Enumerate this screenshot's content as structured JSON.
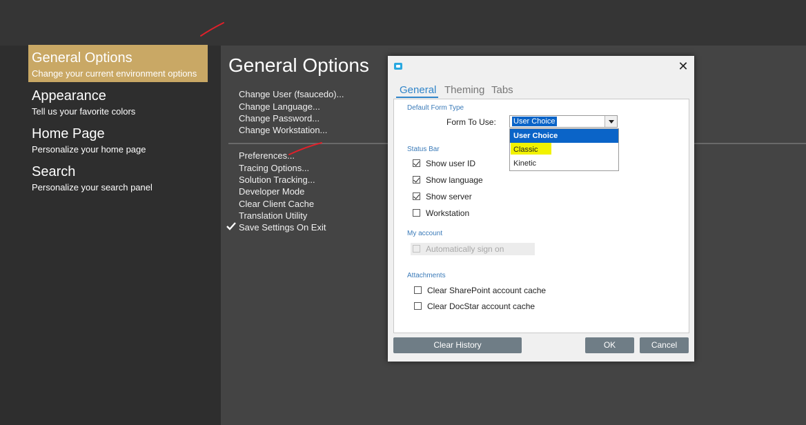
{
  "nav": {
    "items": [
      {
        "title": "General Options",
        "subtitle": "Change your current environment options",
        "active": true
      },
      {
        "title": "Appearance",
        "subtitle": "Tell us your favorite colors",
        "active": false
      },
      {
        "title": "Home Page",
        "subtitle": "Personalize your home page",
        "active": false
      },
      {
        "title": "Search",
        "subtitle": "Personalize your search panel",
        "active": false
      }
    ]
  },
  "main": {
    "title": "General Options",
    "links": [
      "Change User (fsaucedo)...",
      "Change Language...",
      "Change Password...",
      "Change Workstation...",
      "Preferences...",
      "Tracing Options...",
      "Solution Tracking...",
      "Developer Mode",
      "Clear Client Cache",
      "Translation Utility",
      "Save Settings On Exit"
    ]
  },
  "dialog": {
    "tabs": [
      "General",
      "Theming",
      "Tabs"
    ],
    "active_tab": "General",
    "default_form_type": {
      "heading": "Default Form Type",
      "label": "Form To Use:",
      "value": "User Choice",
      "options": [
        "User Choice",
        "Classic",
        "Kinetic"
      ]
    },
    "status_bar": {
      "heading": "Status Bar",
      "items": [
        {
          "label": "Show user ID",
          "checked": true
        },
        {
          "label": "Show language",
          "checked": true
        },
        {
          "label": "Show server",
          "checked": true
        },
        {
          "label": "Workstation",
          "checked": false
        }
      ]
    },
    "my_account": {
      "heading": "My account",
      "auto_sign_on": {
        "label": "Automatically sign on",
        "checked": false,
        "enabled": false
      }
    },
    "attachments": {
      "heading": "Attachments",
      "items": [
        {
          "label": "Clear SharePoint account cache",
          "checked": false
        },
        {
          "label": "Clear DocStar account cache",
          "checked": false
        }
      ]
    },
    "buttons": {
      "clear_history": "Clear History",
      "ok": "OK",
      "cancel": "Cancel"
    }
  },
  "colors": {
    "nav_active": "#c9a865",
    "accent_blue": "#2f84c9",
    "selection": "#0a64c8",
    "highlight": "#f2f200",
    "button": "#6f7d86",
    "annotation": "#e0202a"
  },
  "icons": [
    "app-icon",
    "close-icon",
    "checkmark-icon",
    "dropdown-arrow-icon"
  ]
}
